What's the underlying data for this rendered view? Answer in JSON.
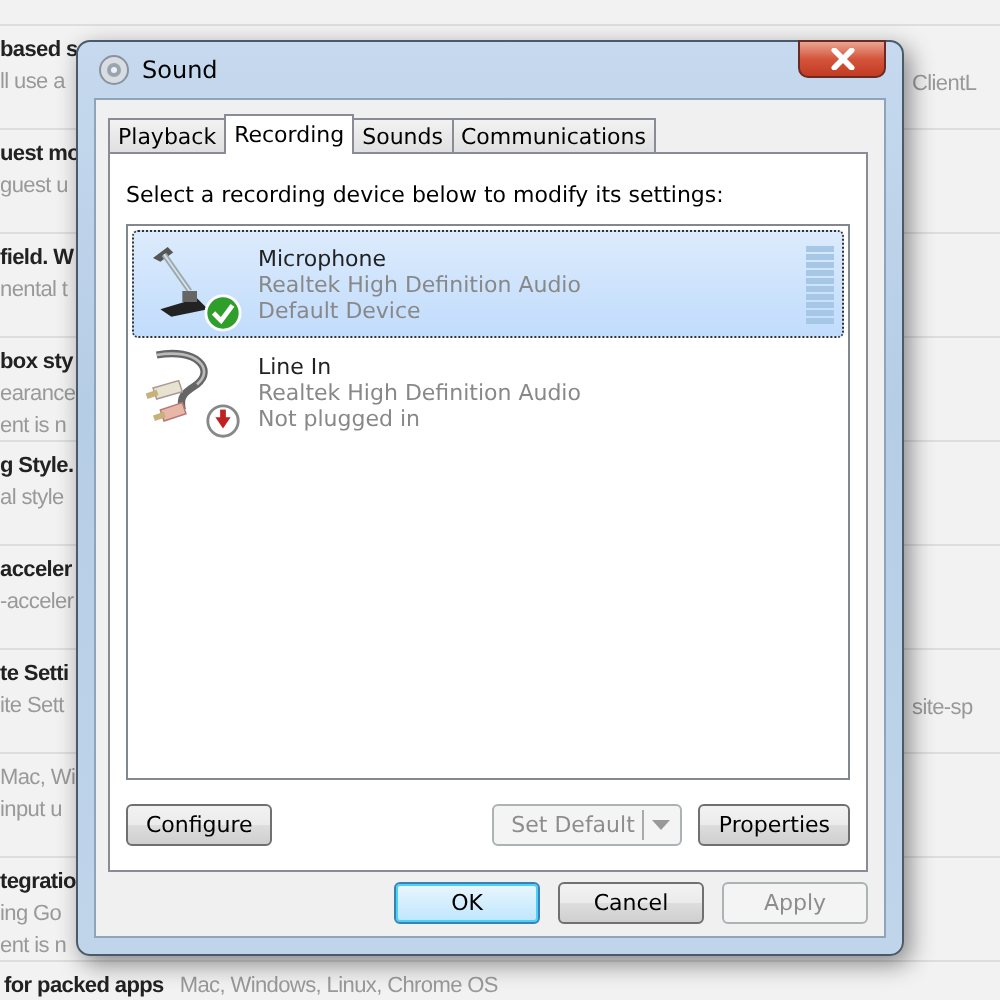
{
  "background_page": {
    "rows": [
      {
        "left": [
          {
            "text": "based s",
            "kind": "title"
          },
          {
            "text": "ll use a",
            "kind": "description"
          }
        ],
        "right": [
          "ClientL"
        ]
      },
      {
        "left": [
          {
            "text": "uest mo",
            "kind": "title"
          },
          {
            "text": "guest u",
            "kind": "description"
          }
        ],
        "right": []
      },
      {
        "left": [
          {
            "text": "field. W",
            "kind": "title"
          },
          {
            "text": "nental t",
            "kind": "description"
          }
        ],
        "right": []
      },
      {
        "left": [
          {
            "text": "box sty",
            "kind": "title"
          },
          {
            "text": "earance",
            "kind": "description"
          },
          {
            "text": "ent is n",
            "kind": "description"
          }
        ],
        "right": []
      },
      {
        "left": [
          {
            "text": "g Style.",
            "kind": "title"
          },
          {
            "text": "al style",
            "kind": "description"
          }
        ],
        "right": []
      },
      {
        "left": [
          {
            "text": "acceler",
            "kind": "title"
          },
          {
            "text": "-acceler",
            "kind": "description"
          }
        ],
        "right": []
      },
      {
        "left": [
          {
            "text": "te Setti",
            "kind": "title"
          },
          {
            "text": "ite Sett",
            "kind": "description"
          }
        ],
        "right": [
          "site-sp"
        ]
      },
      {
        "left": [
          {
            "text": "Mac, Wi",
            "kind": "description"
          },
          {
            "text": "input u",
            "kind": "description"
          }
        ],
        "right": []
      },
      {
        "left": [
          {
            "text": "tegratio",
            "kind": "title"
          },
          {
            "text": "ing Go",
            "kind": "description"
          },
          {
            "text": "ent is n",
            "kind": "description"
          }
        ],
        "right": []
      }
    ],
    "bottom_line": {
      "title": "for packed apps",
      "platforms": "Mac, Windows, Linux, Chrome OS"
    }
  },
  "dialog": {
    "title": "Sound",
    "tabs": [
      {
        "label": "Playback",
        "selected": false
      },
      {
        "label": "Recording",
        "selected": true
      },
      {
        "label": "Sounds",
        "selected": false
      },
      {
        "label": "Communications",
        "selected": false
      }
    ],
    "instruction": "Select a recording device below to modify its settings:",
    "devices": [
      {
        "kind": "microphone",
        "name": "Microphone",
        "driver": "Realtek High Definition Audio",
        "status": "Default Device",
        "default": true,
        "plugged_in": true,
        "selected": true
      },
      {
        "kind": "line_in",
        "name": "Line In",
        "driver": "Realtek High Definition Audio",
        "status": "Not plugged in",
        "default": false,
        "plugged_in": false,
        "selected": false
      }
    ],
    "panel_buttons": [
      {
        "label": "Configure",
        "kind": "plain",
        "disabled": false
      },
      {
        "label": "Set Default",
        "kind": "split",
        "disabled": true
      },
      {
        "label": "Properties",
        "kind": "plain",
        "disabled": false
      }
    ],
    "buttons": [
      {
        "label": "OK",
        "default": true,
        "disabled": false
      },
      {
        "label": "Cancel",
        "default": false,
        "disabled": false
      },
      {
        "label": "Apply",
        "default": false,
        "disabled": true
      }
    ]
  }
}
